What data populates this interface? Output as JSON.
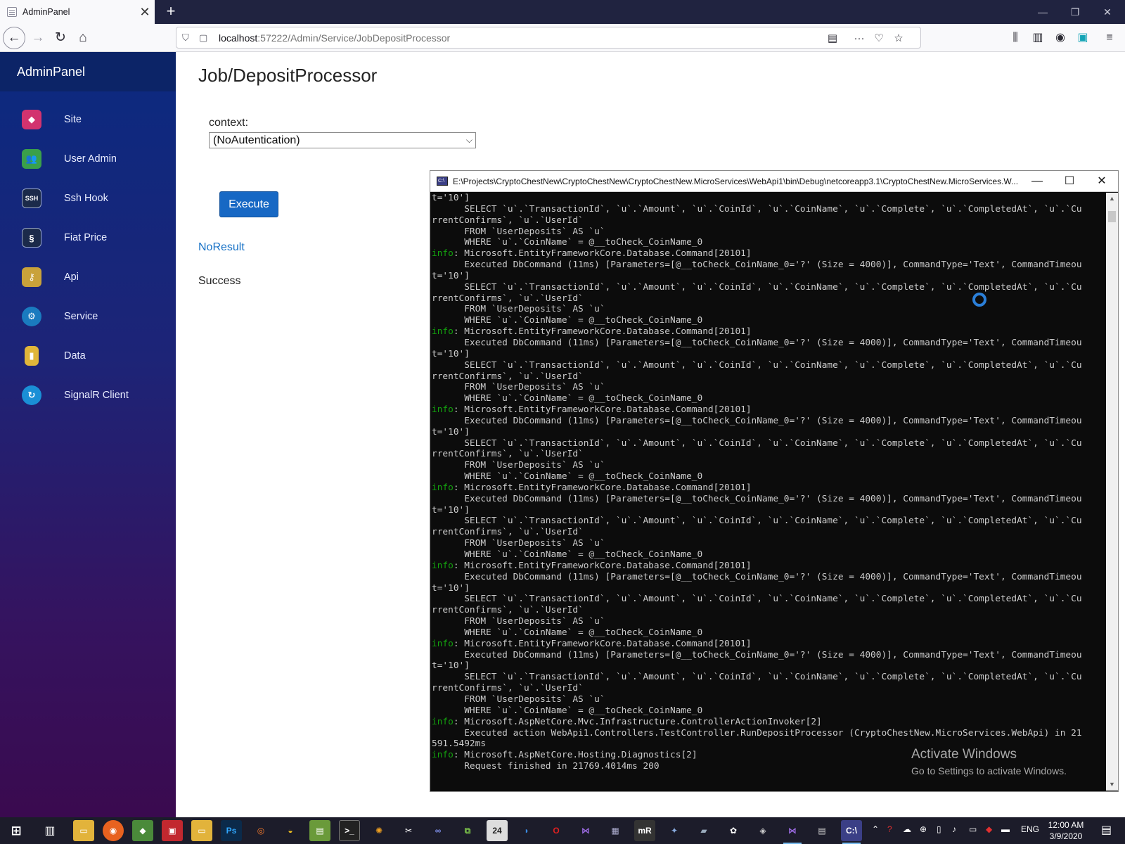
{
  "browser": {
    "tab_title": "AdminPanel",
    "tab_close": "✕",
    "new_tab": "+",
    "url_host": "localhost",
    "url_rest": ":57222/Admin/Service/JobDepositProcessor",
    "window_controls": [
      "—",
      "❐",
      "✕"
    ]
  },
  "sidebar": {
    "brand": "AdminPanel",
    "items": [
      {
        "label": "Site",
        "icon": "site-cube-icon",
        "color": "#d2336f"
      },
      {
        "label": "User Admin",
        "icon": "users-icon",
        "color": "#3aa04a"
      },
      {
        "label": "Ssh Hook",
        "icon": "ssh-terminal-icon",
        "color": "#1b2a4a"
      },
      {
        "label": "Fiat Price",
        "icon": "fiat-price-icon",
        "color": "#1b2a4a"
      },
      {
        "label": "Api",
        "icon": "api-keys-icon",
        "color": "#c9a23a"
      },
      {
        "label": "Service",
        "icon": "service-gears-icon",
        "color": "#1a7bbf"
      },
      {
        "label": "Data",
        "icon": "data-jar-icon",
        "color": "#e0b63a"
      },
      {
        "label": "SignalR Client",
        "icon": "signalr-icon",
        "color": "#1a8fd6"
      }
    ]
  },
  "main": {
    "title": "Job/DepositProcessor",
    "context_label": "context:",
    "context_value": "(NoAutentication)",
    "execute_label": "Execute",
    "result_link": "NoResult",
    "status": "Success"
  },
  "console": {
    "title": "E:\\Projects\\CryptoChestNew\\CryptoChestNew\\CryptoChestNew.MicroServices\\WebApi1\\bin\\Debug\\netcoreapp3.1\\CryptoChestNew.MicroServices.W...",
    "lines": [
      {
        "p": "",
        "t": "t='10']"
      },
      {
        "p": "",
        "t": "      SELECT `u`.`TransactionId`, `u`.`Amount`, `u`.`CoinId`, `u`.`CoinName`, `u`.`Complete`, `u`.`CompletedAt`, `u`.`Cu"
      },
      {
        "p": "",
        "t": "rrentConfirms`, `u`.`UserId`"
      },
      {
        "p": "",
        "t": "      FROM `UserDeposits` AS `u`"
      },
      {
        "p": "",
        "t": "      WHERE `u`.`CoinName` = @__toCheck_CoinName_0"
      },
      {
        "p": "info",
        "t": ": Microsoft.EntityFrameworkCore.Database.Command[20101]"
      },
      {
        "p": "",
        "t": "      Executed DbCommand (11ms) [Parameters=[@__toCheck_CoinName_0='?' (Size = 4000)], CommandType='Text', CommandTimeou"
      },
      {
        "p": "",
        "t": "t='10']"
      },
      {
        "p": "",
        "t": "      SELECT `u`.`TransactionId`, `u`.`Amount`, `u`.`CoinId`, `u`.`CoinName`, `u`.`Complete`, `u`.`CompletedAt`, `u`.`Cu"
      },
      {
        "p": "",
        "t": "rrentConfirms`, `u`.`UserId`"
      },
      {
        "p": "",
        "t": "      FROM `UserDeposits` AS `u`"
      },
      {
        "p": "",
        "t": "      WHERE `u`.`CoinName` = @__toCheck_CoinName_0"
      },
      {
        "p": "info",
        "t": ": Microsoft.EntityFrameworkCore.Database.Command[20101]"
      },
      {
        "p": "",
        "t": "      Executed DbCommand (11ms) [Parameters=[@__toCheck_CoinName_0='?' (Size = 4000)], CommandType='Text', CommandTimeou"
      },
      {
        "p": "",
        "t": "t='10']"
      },
      {
        "p": "",
        "t": "      SELECT `u`.`TransactionId`, `u`.`Amount`, `u`.`CoinId`, `u`.`CoinName`, `u`.`Complete`, `u`.`CompletedAt`, `u`.`Cu"
      },
      {
        "p": "",
        "t": "rrentConfirms`, `u`.`UserId`"
      },
      {
        "p": "",
        "t": "      FROM `UserDeposits` AS `u`"
      },
      {
        "p": "",
        "t": "      WHERE `u`.`CoinName` = @__toCheck_CoinName_0"
      },
      {
        "p": "info",
        "t": ": Microsoft.EntityFrameworkCore.Database.Command[20101]"
      },
      {
        "p": "",
        "t": "      Executed DbCommand (11ms) [Parameters=[@__toCheck_CoinName_0='?' (Size = 4000)], CommandType='Text', CommandTimeou"
      },
      {
        "p": "",
        "t": "t='10']"
      },
      {
        "p": "",
        "t": "      SELECT `u`.`TransactionId`, `u`.`Amount`, `u`.`CoinId`, `u`.`CoinName`, `u`.`Complete`, `u`.`CompletedAt`, `u`.`Cu"
      },
      {
        "p": "",
        "t": "rrentConfirms`, `u`.`UserId`"
      },
      {
        "p": "",
        "t": "      FROM `UserDeposits` AS `u`"
      },
      {
        "p": "",
        "t": "      WHERE `u`.`CoinName` = @__toCheck_CoinName_0"
      },
      {
        "p": "info",
        "t": ": Microsoft.EntityFrameworkCore.Database.Command[20101]"
      },
      {
        "p": "",
        "t": "      Executed DbCommand (11ms) [Parameters=[@__toCheck_CoinName_0='?' (Size = 4000)], CommandType='Text', CommandTimeou"
      },
      {
        "p": "",
        "t": "t='10']"
      },
      {
        "p": "",
        "t": "      SELECT `u`.`TransactionId`, `u`.`Amount`, `u`.`CoinId`, `u`.`CoinName`, `u`.`Complete`, `u`.`CompletedAt`, `u`.`Cu"
      },
      {
        "p": "",
        "t": "rrentConfirms`, `u`.`UserId`"
      },
      {
        "p": "",
        "t": "      FROM `UserDeposits` AS `u`"
      },
      {
        "p": "",
        "t": "      WHERE `u`.`CoinName` = @__toCheck_CoinName_0"
      },
      {
        "p": "info",
        "t": ": Microsoft.EntityFrameworkCore.Database.Command[20101]"
      },
      {
        "p": "",
        "t": "      Executed DbCommand (11ms) [Parameters=[@__toCheck_CoinName_0='?' (Size = 4000)], CommandType='Text', CommandTimeou"
      },
      {
        "p": "",
        "t": "t='10']"
      },
      {
        "p": "",
        "t": "      SELECT `u`.`TransactionId`, `u`.`Amount`, `u`.`CoinId`, `u`.`CoinName`, `u`.`Complete`, `u`.`CompletedAt`, `u`.`Cu"
      },
      {
        "p": "",
        "t": "rrentConfirms`, `u`.`UserId`"
      },
      {
        "p": "",
        "t": "      FROM `UserDeposits` AS `u`"
      },
      {
        "p": "",
        "t": "      WHERE `u`.`CoinName` = @__toCheck_CoinName_0"
      },
      {
        "p": "info",
        "t": ": Microsoft.EntityFrameworkCore.Database.Command[20101]"
      },
      {
        "p": "",
        "t": "      Executed DbCommand (11ms) [Parameters=[@__toCheck_CoinName_0='?' (Size = 4000)], CommandType='Text', CommandTimeou"
      },
      {
        "p": "",
        "t": "t='10']"
      },
      {
        "p": "",
        "t": "      SELECT `u`.`TransactionId`, `u`.`Amount`, `u`.`CoinId`, `u`.`CoinName`, `u`.`Complete`, `u`.`CompletedAt`, `u`.`Cu"
      },
      {
        "p": "",
        "t": "rrentConfirms`, `u`.`UserId`"
      },
      {
        "p": "",
        "t": "      FROM `UserDeposits` AS `u`"
      },
      {
        "p": "",
        "t": "      WHERE `u`.`CoinName` = @__toCheck_CoinName_0"
      },
      {
        "p": "info",
        "t": ": Microsoft.AspNetCore.Mvc.Infrastructure.ControllerActionInvoker[2]"
      },
      {
        "p": "",
        "t": "      Executed action WebApi1.Controllers.TestController.RunDepositProcessor (CryptoChestNew.MicroServices.WebApi) in 21"
      },
      {
        "p": "",
        "t": "591.5492ms"
      },
      {
        "p": "info",
        "t": ": Microsoft.AspNetCore.Hosting.Diagnostics[2]"
      },
      {
        "p": "",
        "t": "      Request finished in 21769.4014ms 200"
      }
    ],
    "watermark_title": "Activate Windows",
    "watermark_sub": "Go to Settings to activate Windows."
  },
  "taskbar": {
    "language": "ENG",
    "time": "12:00 AM",
    "date": "3/9/2020"
  }
}
